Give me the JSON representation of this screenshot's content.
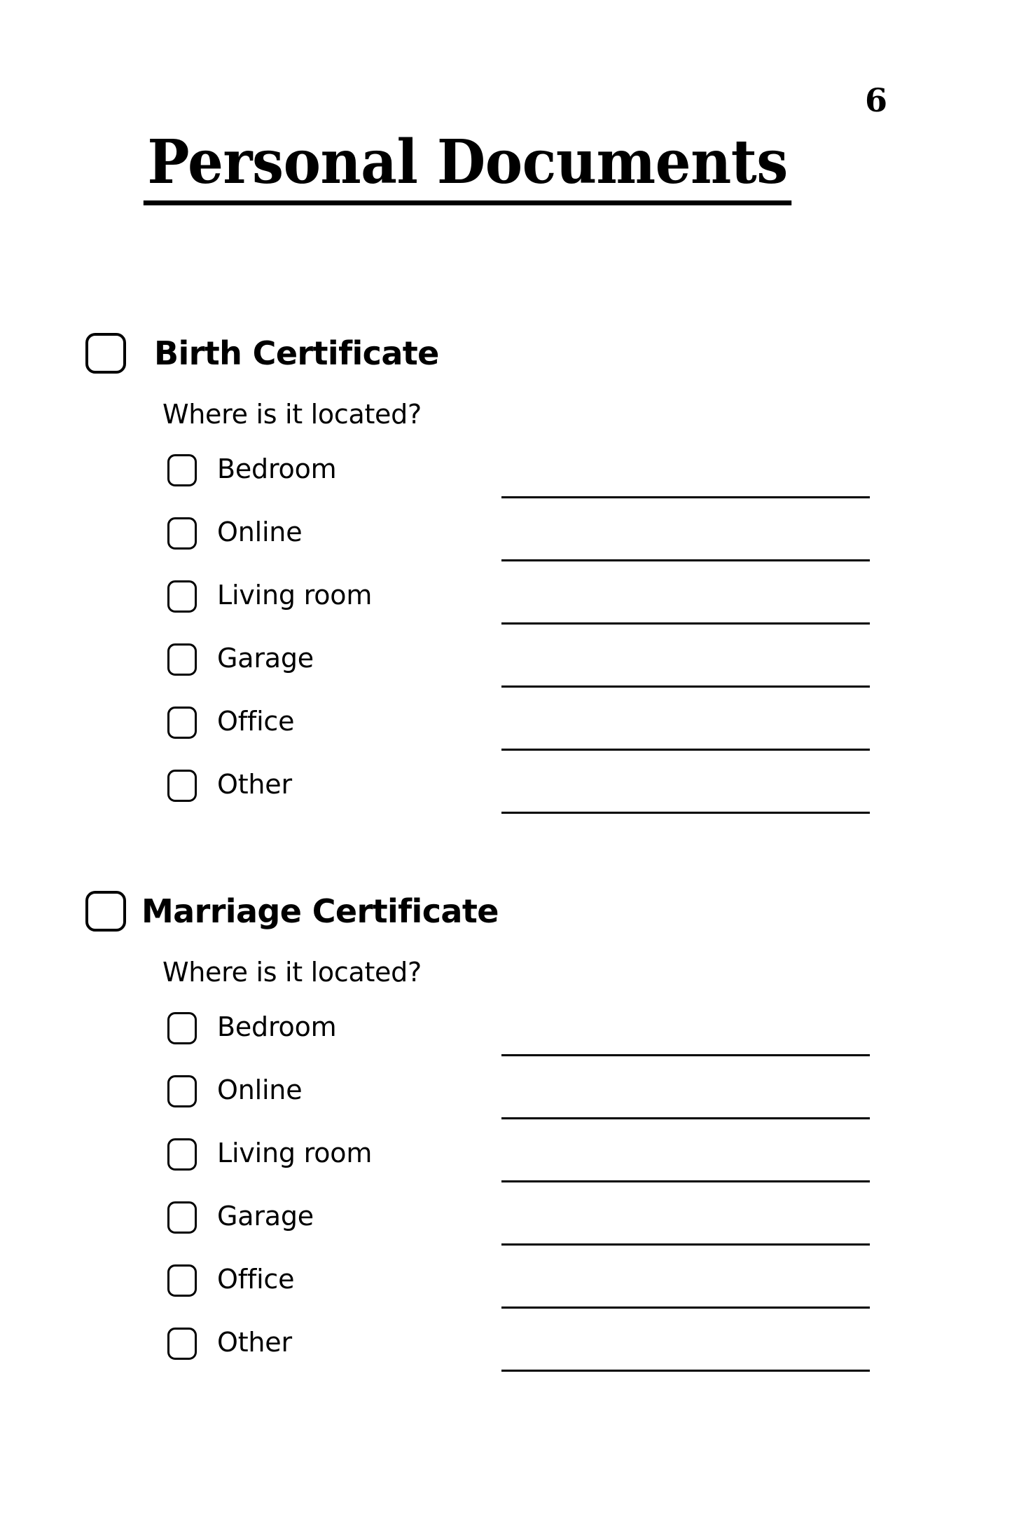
{
  "document": {
    "page_number": "6",
    "title": "Personal Documents"
  },
  "sections": [
    {
      "title": "Birth Certificate",
      "checkbox_name": "birth-certificate",
      "question": "Where is it located?",
      "options": [
        {
          "label": "Bedroom"
        },
        {
          "label": "Online"
        },
        {
          "label": "Living room"
        },
        {
          "label": "Garage"
        },
        {
          "label": "Office"
        },
        {
          "label": "Other"
        }
      ]
    },
    {
      "title": "Marriage Certificate",
      "checkbox_name": "marriage-certificate",
      "question": "Where is it located?",
      "options": [
        {
          "label": "Bedroom"
        },
        {
          "label": "Online"
        },
        {
          "label": "Living room"
        },
        {
          "label": "Garage"
        },
        {
          "label": "Office"
        },
        {
          "label": "Other"
        }
      ]
    }
  ],
  "colors": {
    "ink": "#000000",
    "paper": "#ffffff"
  }
}
